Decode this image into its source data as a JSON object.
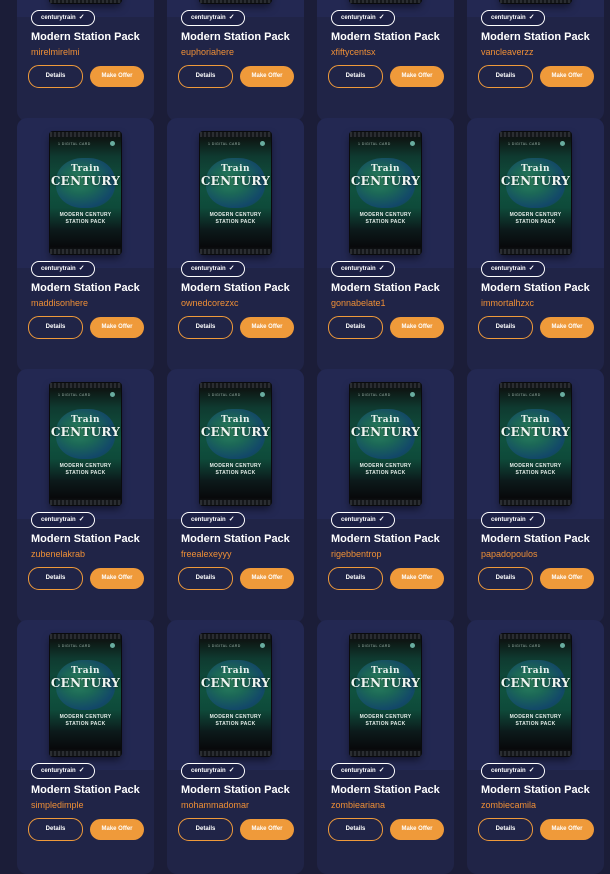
{
  "card_title": "Modern Station Pack",
  "creator_badge": "centurytrain",
  "check_icon": "check-icon",
  "buttons": {
    "details": "Details",
    "make_offer": "Make Offer"
  },
  "pack_art": {
    "tagline": "1 DIGITAL CARD",
    "logo_line1": "Train",
    "logo_line2": "CENTURY",
    "subtitle_line1": "MODERN CENTURY",
    "subtitle_line2": "STATION PACK"
  },
  "colors": {
    "background": "#1b1d38",
    "card": "#202447",
    "accent": "#ef9a3a",
    "owner_text": "#ef8f36"
  },
  "rows": [
    [
      "mirelmirelmi",
      "euphoriahere",
      "xfiftycentsx",
      "vancleaverzz"
    ],
    [
      "maddisonhere",
      "ownedcorezxc",
      "gonnabelate1",
      "immortalhzxc"
    ],
    [
      "zubenelakrab",
      "freealexeyyy",
      "rigebbentrop",
      "papadopoulos"
    ],
    [
      "simpledimple",
      "mohammadomar",
      "zombieariana",
      "zombiecamila"
    ]
  ]
}
